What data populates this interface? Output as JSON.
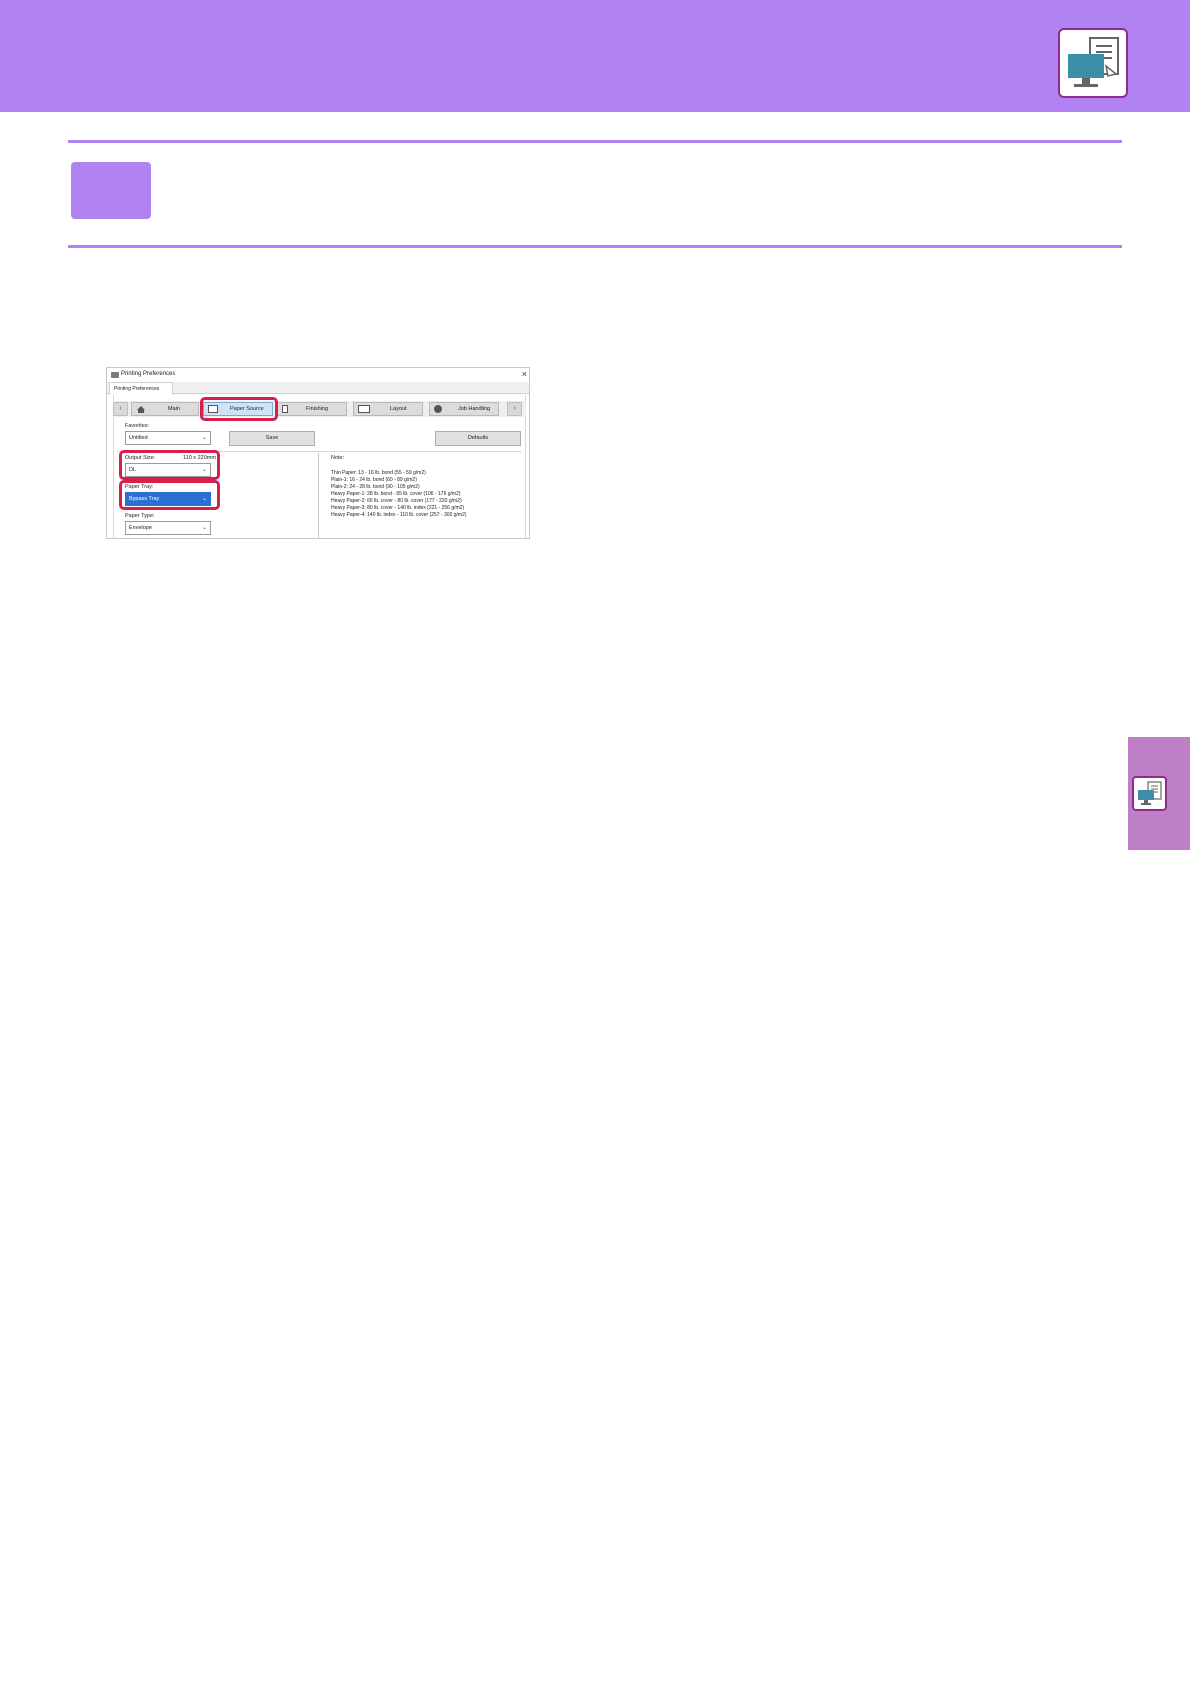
{
  "dialog": {
    "title": "Printing Preferences",
    "close_glyph": "×",
    "tab_label": "Printing Preferences",
    "nav_prev": "‹",
    "nav_next": "›",
    "tabs": [
      "Main",
      "Paper Source",
      "Finishing",
      "Layout",
      "Job Handling"
    ],
    "favorites_label": "Favorites:",
    "favorites_value": "Untitled",
    "save_label": "Save",
    "defaults_label": "Defaults",
    "output_size_label": "Output Size:",
    "output_size_dim": "110 x 220mm",
    "output_size_value": "DL",
    "paper_tray_label": "Paper Tray:",
    "paper_tray_value": "Bypass Tray",
    "paper_type_label": "Paper Type:",
    "paper_type_value": "Envelope",
    "note_label": "Note:",
    "notes": [
      "Thin Paper: 13 - 16 lb. bond (55 - 59 g/m2)",
      "Plain-1: 16 - 24 lb. bond (60 - 89 g/m2)",
      "Plain-2: 24 - 28 lb. bond (90 - 105 g/m2)",
      "Heavy Paper-1: 28 lb. bond - 65 lb. cover (106 - 176 g/m2)",
      "Heavy Paper-2: 65 lb. cover - 80 lb. cover (177 - 220 g/m2)",
      "Heavy Paper-3: 80 lb. cover - 140 lb. index (221 - 256 g/m2)",
      "Heavy Paper-4: 140 lb. index - 110 lb. cover (257 - 300 g/m2)"
    ]
  },
  "colors": {
    "accent": "#b183f2",
    "side_tab": "#bf7fc7",
    "highlight": "#d81e4a",
    "icon_border": "#8e2c8e",
    "monitor": "#3d8fa8"
  },
  "icons": [
    "print-from-pc-icon",
    "print-from-pc-icon-small",
    "printer-icon",
    "home-icon",
    "paper-tray-icon",
    "finishing-icon",
    "layout-icon",
    "job-handling-icon"
  ]
}
